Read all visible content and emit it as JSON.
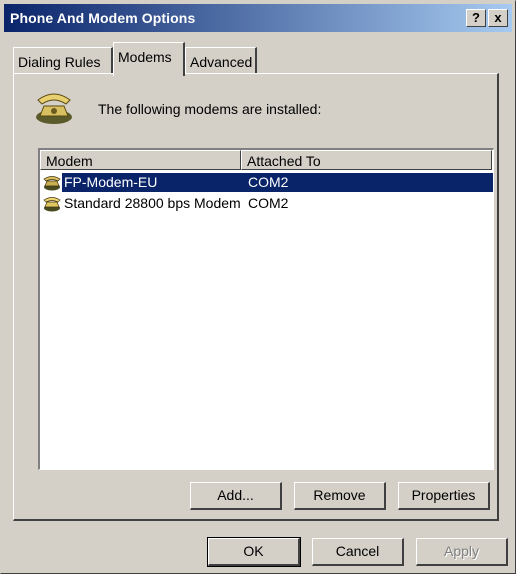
{
  "window": {
    "title": "Phone And Modem Options"
  },
  "titlebar_buttons": {
    "help": "?",
    "close": "x"
  },
  "tabs": [
    {
      "label": "Dialing Rules"
    },
    {
      "label": "Modems"
    },
    {
      "label": "Advanced"
    }
  ],
  "panel": {
    "intro_text": "The following modems are installed:",
    "icons": {
      "header": "telephone-icon",
      "row": "modem-icon"
    }
  },
  "modem_list": {
    "columns": [
      "Modem",
      "Attached To"
    ],
    "rows": [
      {
        "name": "FP-Modem-EU",
        "port": "COM2",
        "selected": true
      },
      {
        "name": "Standard 28800 bps Modem",
        "port": "COM2",
        "selected": false
      }
    ]
  },
  "panel_buttons": {
    "add": "Add...",
    "remove": "Remove",
    "properties": "Properties"
  },
  "dialog_buttons": {
    "ok": "OK",
    "cancel": "Cancel",
    "apply": "Apply"
  },
  "colors": {
    "title_start": "#0a246a",
    "title_end": "#a6caf0",
    "selection": "#0a246a",
    "face": "#d4d0c8"
  }
}
